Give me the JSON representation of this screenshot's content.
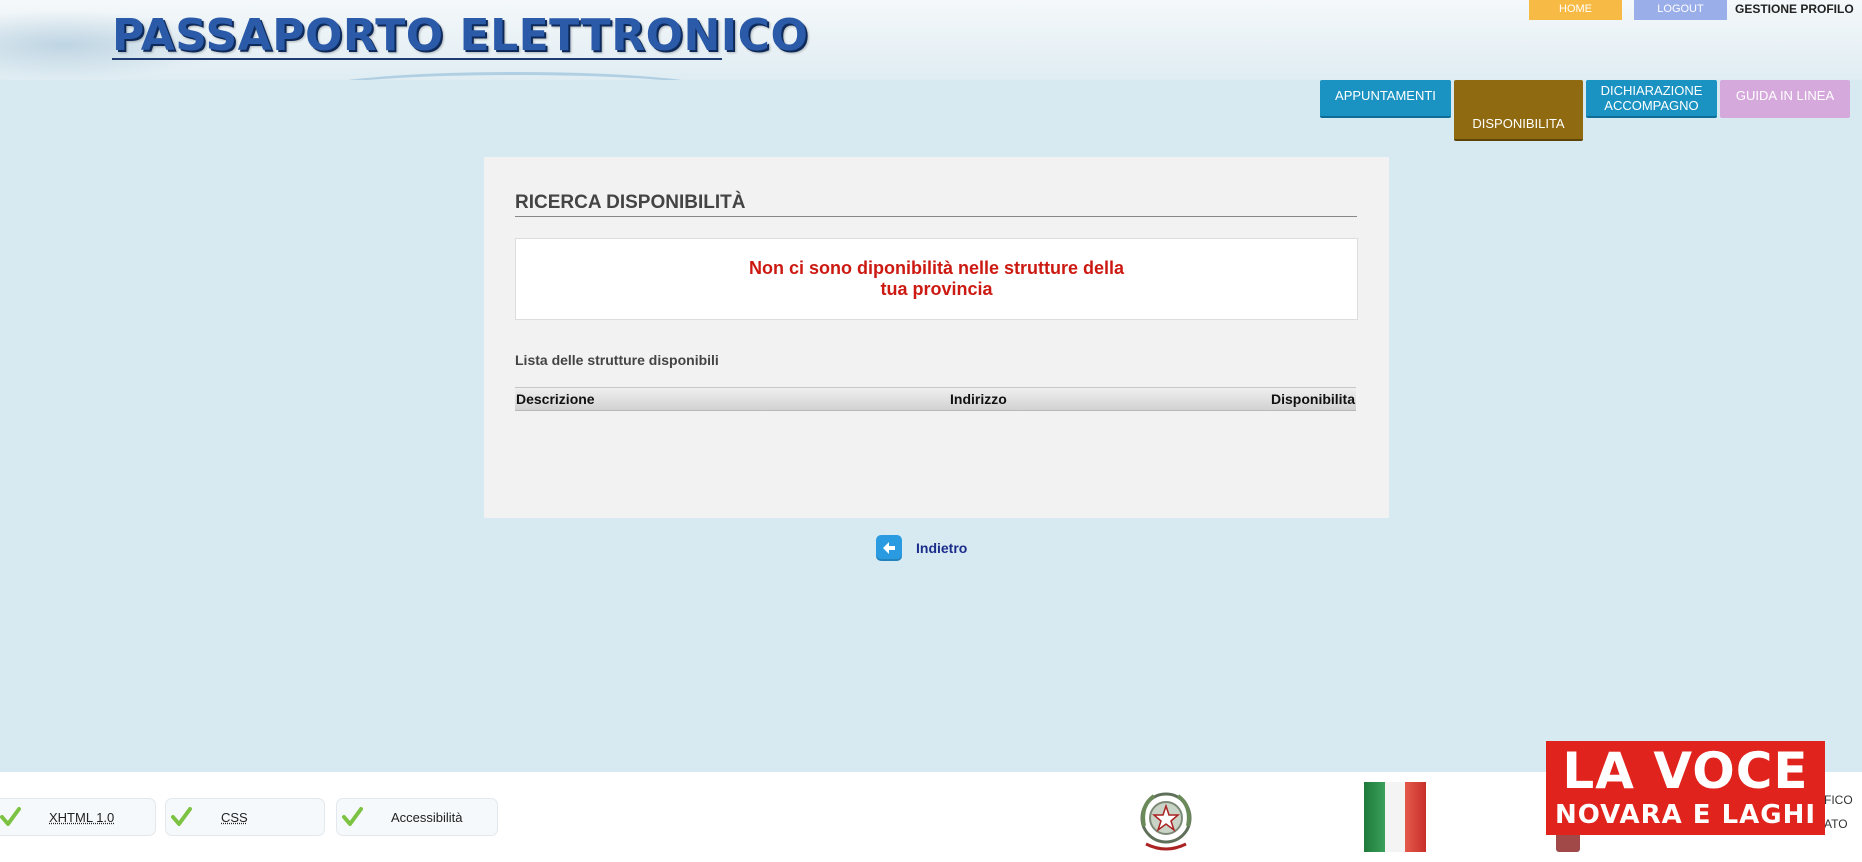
{
  "header": {
    "brand": "PASSAPORTO ELETTRONICO",
    "top_nav": {
      "home": "HOME",
      "logout": "LOGOUT",
      "profile": "GESTIONE PROFILO"
    }
  },
  "tabs": [
    {
      "label": "APPUNTAMENTI",
      "active": false,
      "color": "#1a93c3"
    },
    {
      "label": "DISPONIBILITA",
      "active": true,
      "color": "#8f6a11"
    },
    {
      "label_line1": "DICHIARAZIONE",
      "label_line2": "ACCOMPAGNO",
      "active": false,
      "color": "#1a93c3"
    },
    {
      "label": "GUIDA IN LINEA",
      "active": false,
      "color": "#d6a9dd"
    }
  ],
  "panel": {
    "title": "RICERCA DISPONIBILITÀ",
    "message_line1": "Non ci sono diponibilità nelle strutture della",
    "message_line2": "tua provincia",
    "list_label": "Lista delle strutture disponibili",
    "columns": [
      "Descrizione",
      "Indirizzo",
      "Disponibilita"
    ],
    "rows": []
  },
  "back": {
    "label": "Indietro",
    "icon": "arrow-left-icon"
  },
  "footer": {
    "badges": [
      "XHTML 1.0",
      "CSS",
      "Accessibilità"
    ],
    "right_text_line1": "FICO",
    "right_text_line2": "ATO"
  },
  "watermark": {
    "line1": "LA VOCE",
    "line2": "NOVARA E LAGHI",
    "color": "#e0231c"
  },
  "colors": {
    "background": "#d7eaf2",
    "error_text": "#cc1a12",
    "link": "#1b2d8a"
  }
}
